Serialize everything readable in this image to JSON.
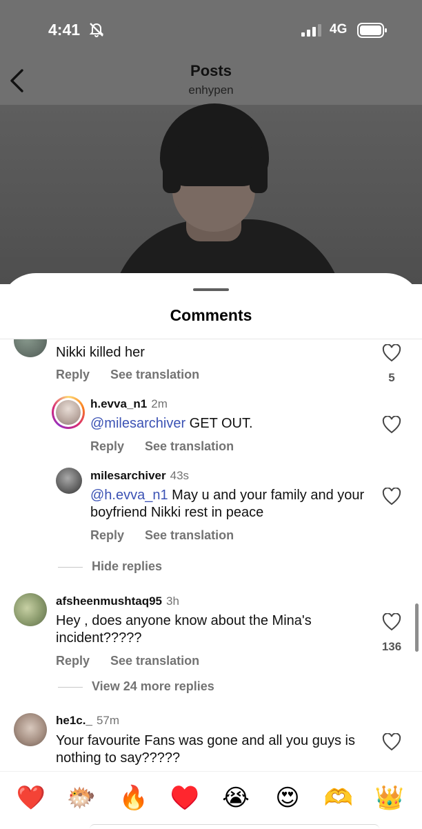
{
  "status": {
    "time": "4:41",
    "network": "4G"
  },
  "header": {
    "title": "Posts",
    "subtitle": "enhypen"
  },
  "sheet": {
    "title": "Comments"
  },
  "comments": [
    {
      "username": "",
      "time": "",
      "text": "Nikki killed her",
      "reply": "Reply",
      "translate": "See translation",
      "likes": "5"
    },
    {
      "username": "h.evva_n1",
      "time": "2m",
      "mention": "@milesarchiver",
      "text": " GET OUT.",
      "reply": "Reply",
      "translate": "See translation"
    },
    {
      "username": "milesarchiver",
      "time": "43s",
      "mention": "@h.evva_n1",
      "text": " May u and your family and your boyfriend Nikki rest in peace",
      "reply": "Reply",
      "translate": "See translation"
    },
    {
      "username": "afsheenmushtaq95",
      "time": "3h",
      "text": "Hey , does anyone know about the Mina's incident?????",
      "reply": "Reply",
      "translate": "See translation",
      "likes": "136"
    },
    {
      "username": "he1c._",
      "time": "57m",
      "text": "Your favourite Fans was gone and all you guys is nothing to say?????"
    }
  ],
  "threads": {
    "hide": "Hide replies",
    "view_more": "View 24 more replies"
  },
  "emoji_bar": [
    "❤️",
    "🐡",
    "🔥",
    "♥️",
    "😭",
    "😍",
    "🫶",
    "👑"
  ],
  "icons": {
    "back": "chevron-left-icon",
    "like": "heart-outline-icon",
    "mute": "bell-slash-icon",
    "signal": "signal-bars-icon",
    "battery": "battery-icon"
  },
  "colors": {
    "mention": "#3b52b4",
    "muted_text": "#737373",
    "story_ring": "#d6249f"
  }
}
